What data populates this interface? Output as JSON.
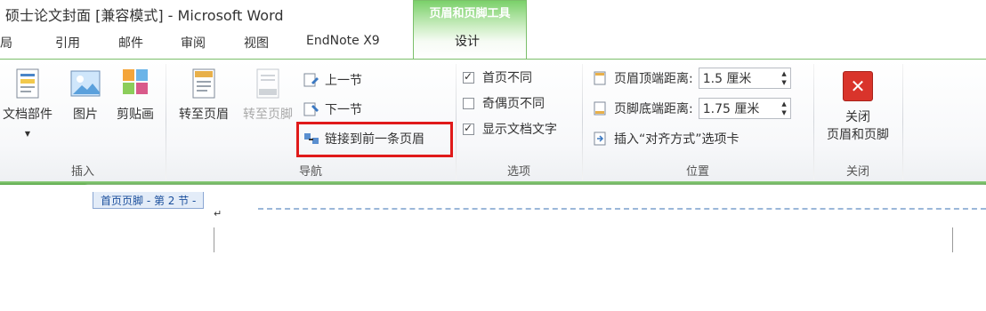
{
  "window": {
    "title": "硕士论文封面 [兼容模式] - Microsoft Word"
  },
  "context_tab_group": {
    "label": "页眉和页脚工具"
  },
  "tabs": [
    {
      "label": "布局"
    },
    {
      "label": "引用"
    },
    {
      "label": "邮件"
    },
    {
      "label": "审阅"
    },
    {
      "label": "视图"
    },
    {
      "label": "EndNote X9"
    },
    {
      "label": "设计"
    }
  ],
  "ribbon": {
    "insert_group": {
      "label": "插入",
      "doc_parts": "文档部件",
      "picture": "图片",
      "clip_art": "剪贴画"
    },
    "nav_group": {
      "label": "导航",
      "goto_header": "转至页眉",
      "goto_footer": "转至页脚",
      "prev_section": "上一节",
      "next_section": "下一节",
      "link_previous": "链接到前一条页眉"
    },
    "options_group": {
      "label": "选项",
      "diff_first_page": "首页不同",
      "odd_even_diff": "奇偶页不同",
      "show_doc_text": "显示文档文字"
    },
    "position_group": {
      "label": "位置",
      "header_top_label": "页眉顶端距离:",
      "header_top_value": "1.5 厘米",
      "footer_bottom_label": "页脚底端距离:",
      "footer_bottom_value": "1.75 厘米",
      "insert_align_tab": "插入“对齐方式”选项卡"
    },
    "close_group": {
      "label": "关闭",
      "close_button": "关闭\n页眉和页脚"
    }
  },
  "document": {
    "header_tag": "首页页脚 - 第 2 节 -",
    "paragraph_mark": "↵"
  },
  "colors": {
    "context_green": "#7bd06a",
    "highlight_red": "#e01a1a",
    "close_red": "#d9342b"
  }
}
